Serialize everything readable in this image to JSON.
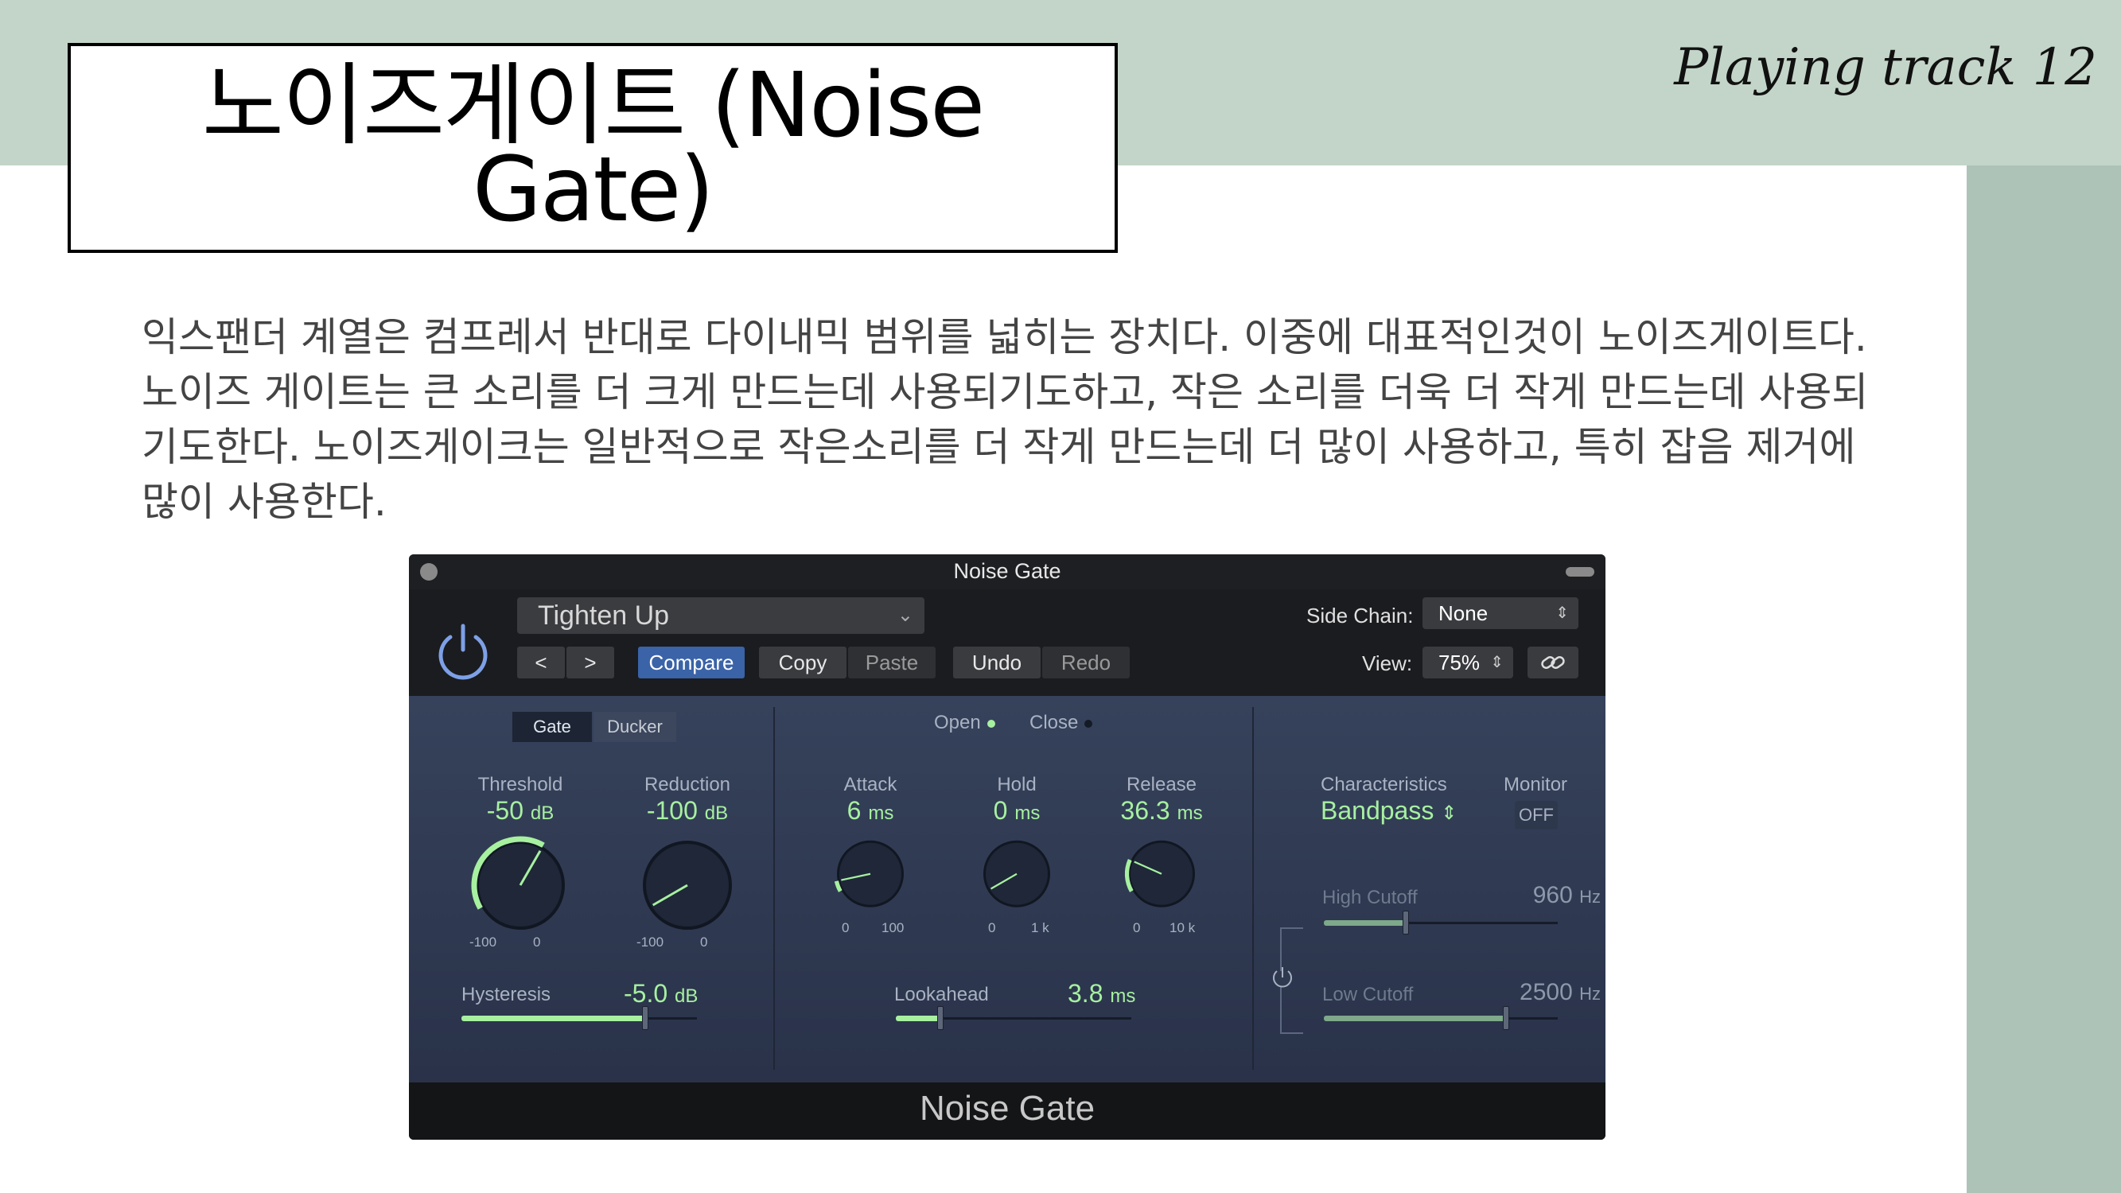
{
  "slide": {
    "title": "노이즈게이트 (Noise Gate)",
    "corner_note": "Playing track 12",
    "body": "익스팬더 계열은 컴프레서 반대로 다이내믹 범위를 넓히는 장치다. 이중에 대표적인것이 노이즈게이트다. 노이즈 게이트는 큰 소리를 더 크게 만드는데 사용되기도하고, 작은 소리를 더욱 더 작게 만드는데 사용되기도한다. 노이즈게이크는 일반적으로 작은소리를 더 작게 만드는데 더 많이 사용하고, 특히 잡음 제거에 많이 사용한다."
  },
  "colors": {
    "top_band": "#c3d5c8",
    "side_band": "#aec3b7",
    "accent_green": "#a7f0a0",
    "compare_blue": "#3a63a8",
    "power_blue": "#7da0e6"
  },
  "plugin": {
    "window_title": "Noise Gate",
    "preset": "Tighten Up",
    "nav_prev": "<",
    "nav_next": ">",
    "compare": "Compare",
    "copy": "Copy",
    "paste": "Paste",
    "undo": "Undo",
    "redo": "Redo",
    "side_chain_label": "Side Chain:",
    "side_chain_value": "None",
    "view_label": "View:",
    "view_value": "75%",
    "mode_gate": "Gate",
    "mode_ducker": "Ducker",
    "open_label": "Open",
    "close_label": "Close",
    "threshold": {
      "label": "Threshold",
      "value": "-50",
      "unit": "dB",
      "min": "-100",
      "max": "0",
      "level": 0.5
    },
    "reduction": {
      "label": "Reduction",
      "value": "-100",
      "unit": "dB",
      "min": "-100",
      "max": "0",
      "level": 0.0
    },
    "attack": {
      "label": "Attack",
      "value": "6",
      "unit": "ms",
      "min": "0",
      "max": "100",
      "level": 0.06
    },
    "hold": {
      "label": "Hold",
      "value": "0",
      "unit": "ms",
      "min": "0",
      "max": "1 k",
      "level": 0.0
    },
    "release": {
      "label": "Release",
      "value": "36.3",
      "unit": "ms",
      "min": "0",
      "max": "10 k",
      "level": 0.18
    },
    "hysteresis": {
      "label": "Hysteresis",
      "value": "-5.0",
      "unit": "dB",
      "level": 0.78
    },
    "lookahead": {
      "label": "Lookahead",
      "value": "3.8",
      "unit": "ms",
      "level": 0.19
    },
    "characteristics_label": "Characteristics",
    "characteristics_value": "Bandpass",
    "monitor_label": "Monitor",
    "monitor_value": "OFF",
    "high_cutoff": {
      "label": "High Cutoff",
      "value": "960",
      "unit": "Hz",
      "level": 0.35
    },
    "low_cutoff": {
      "label": "Low Cutoff",
      "value": "2500",
      "unit": "Hz",
      "level": 0.78
    },
    "footer_title": "Noise Gate"
  }
}
